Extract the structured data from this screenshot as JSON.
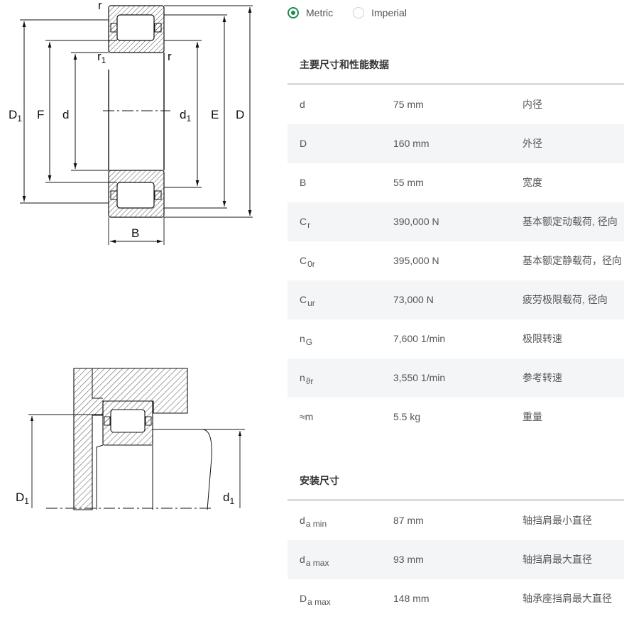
{
  "unit_options": {
    "metric_label": "Metric",
    "imperial_label": "Imperial",
    "selected": "Metric"
  },
  "diagram_top_labels": {
    "D1": "D",
    "D1_sub": "1",
    "F": "F",
    "d": "d",
    "d1": "d",
    "d1_sub": "1",
    "E": "E",
    "D": "D",
    "B": "B",
    "r_top": "r",
    "r1": "r",
    "r1_sub": "1",
    "r_right": "r"
  },
  "diagram_bottom_labels": {
    "D1": "D",
    "D1_sub": "1",
    "d1": "d",
    "d1_sub": "1"
  },
  "dimensions_section": {
    "title": "主要尺寸和性能数据",
    "rows": [
      {
        "symbol": "d",
        "sub": "",
        "value": "75 mm",
        "desc": "内径"
      },
      {
        "symbol": "D",
        "sub": "",
        "value": "160 mm",
        "desc": "外径"
      },
      {
        "symbol": "B",
        "sub": "",
        "value": "55 mm",
        "desc": "宽度"
      },
      {
        "symbol": "C",
        "sub": "r",
        "value": "390,000 N",
        "desc": "基本额定动载荷, 径向"
      },
      {
        "symbol": "C",
        "sub": "0r",
        "value": "395,000 N",
        "desc": "基本额定静载荷，径向"
      },
      {
        "symbol": "C",
        "sub": "ur",
        "value": "73,000 N",
        "desc": "疲劳极限载荷, 径向"
      },
      {
        "symbol": "n",
        "sub": "G",
        "value": "7,600 1/min",
        "desc": "极限转速"
      },
      {
        "symbol": "n",
        "sub": "ϑr",
        "value": "3,550 1/min",
        "desc": "参考转速"
      },
      {
        "symbol": "≈m",
        "sub": "",
        "value": "5.5 kg",
        "desc": "重量"
      }
    ]
  },
  "mounting_section": {
    "title": "安装尺寸",
    "rows": [
      {
        "symbol": "d",
        "sub": "a min",
        "value": "87 mm",
        "desc": "轴挡肩最小直径"
      },
      {
        "symbol": "d",
        "sub": "a max",
        "value": "93 mm",
        "desc": "轴挡肩最大直径"
      },
      {
        "symbol": "D",
        "sub": "a max",
        "value": "148 mm",
        "desc": "轴承座挡肩最大直径"
      }
    ]
  }
}
